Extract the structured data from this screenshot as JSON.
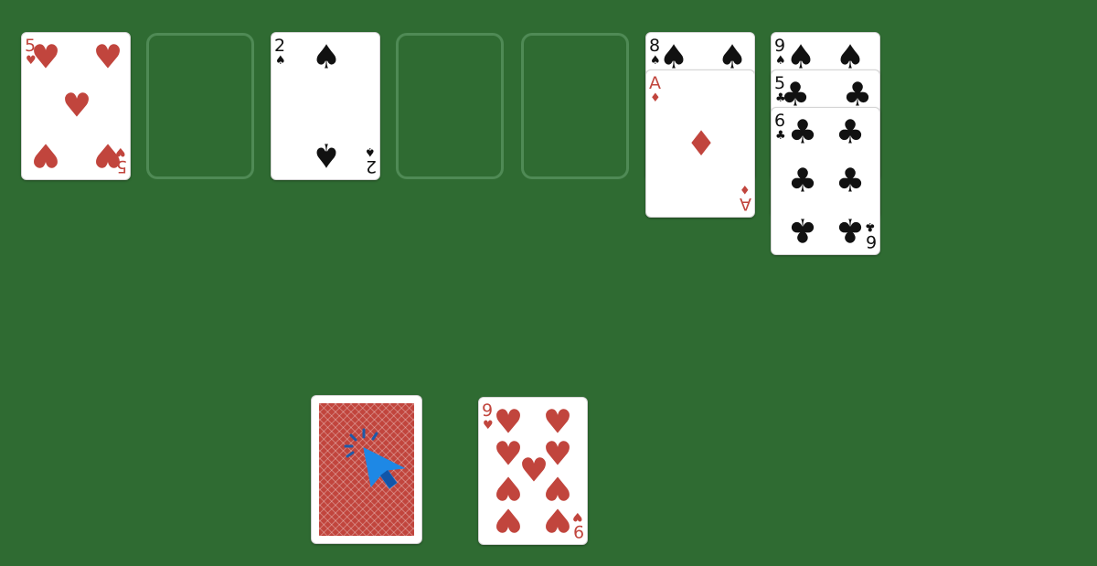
{
  "colors": {
    "table": "#2f6b32",
    "red": "#c1453d",
    "black": "#111111",
    "slot_outline": "#4f8a55",
    "cursor": "#1e88e5"
  },
  "slots": [
    {
      "name": "slot-1",
      "card": {
        "rank": "5",
        "suit": "♥"
      }
    },
    {
      "name": "slot-2",
      "card": null
    },
    {
      "name": "slot-3",
      "card": {
        "rank": "2",
        "suit": "♠"
      }
    },
    {
      "name": "slot-4",
      "card": null
    },
    {
      "name": "slot-5",
      "card": null
    }
  ],
  "piles": [
    {
      "name": "pile-1",
      "cards": [
        {
          "rank": "8",
          "suit": "♠"
        },
        {
          "rank": "A",
          "suit": "♦"
        }
      ]
    },
    {
      "name": "pile-2",
      "cards": [
        {
          "rank": "9",
          "suit": "♠"
        },
        {
          "rank": "5",
          "suit": "♣"
        },
        {
          "rank": "6",
          "suit": "♣"
        }
      ]
    }
  ],
  "stock": {
    "face": "down",
    "cursor_icon": "pointer-click-icon"
  },
  "waste": {
    "rank": "9",
    "suit": "♥"
  }
}
